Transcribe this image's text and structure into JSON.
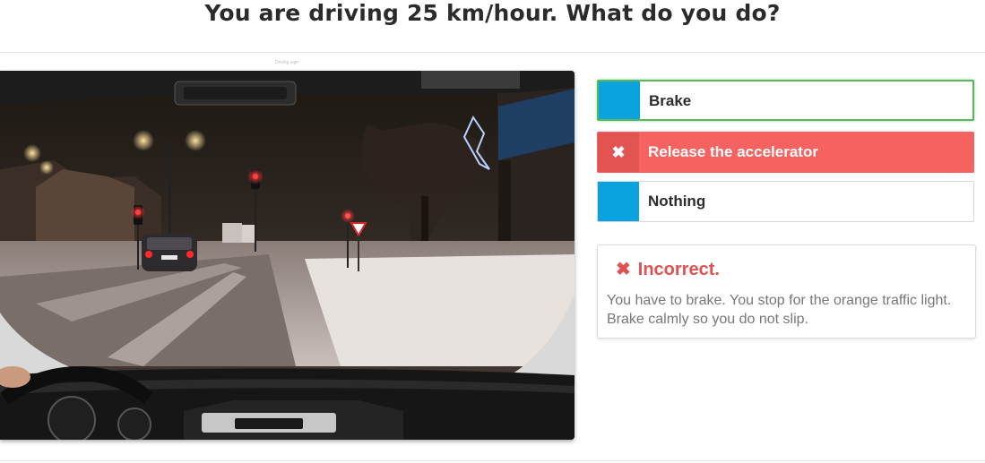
{
  "question": {
    "title": "You are driving 25 km/hour. What do you do?"
  },
  "image": {
    "caption": "Driving sign"
  },
  "answers": [
    {
      "label": "Brake",
      "state": "selected",
      "marker_color": "#0aa3e0"
    },
    {
      "label": "Release the accelerator",
      "state": "wrong",
      "icon": "close-icon"
    },
    {
      "label": "Nothing",
      "state": "normal",
      "marker_color": "#0aa3e0"
    }
  ],
  "feedback": {
    "status": "Incorrect.",
    "icon": "close-icon",
    "text": "You have to brake. You stop for the orange traffic light. Brake calmly so you do not slip."
  },
  "colors": {
    "accent": "#0aa3e0",
    "selected_border": "#58b85c",
    "wrong": "#f66260",
    "feedback_title": "#e05252"
  }
}
